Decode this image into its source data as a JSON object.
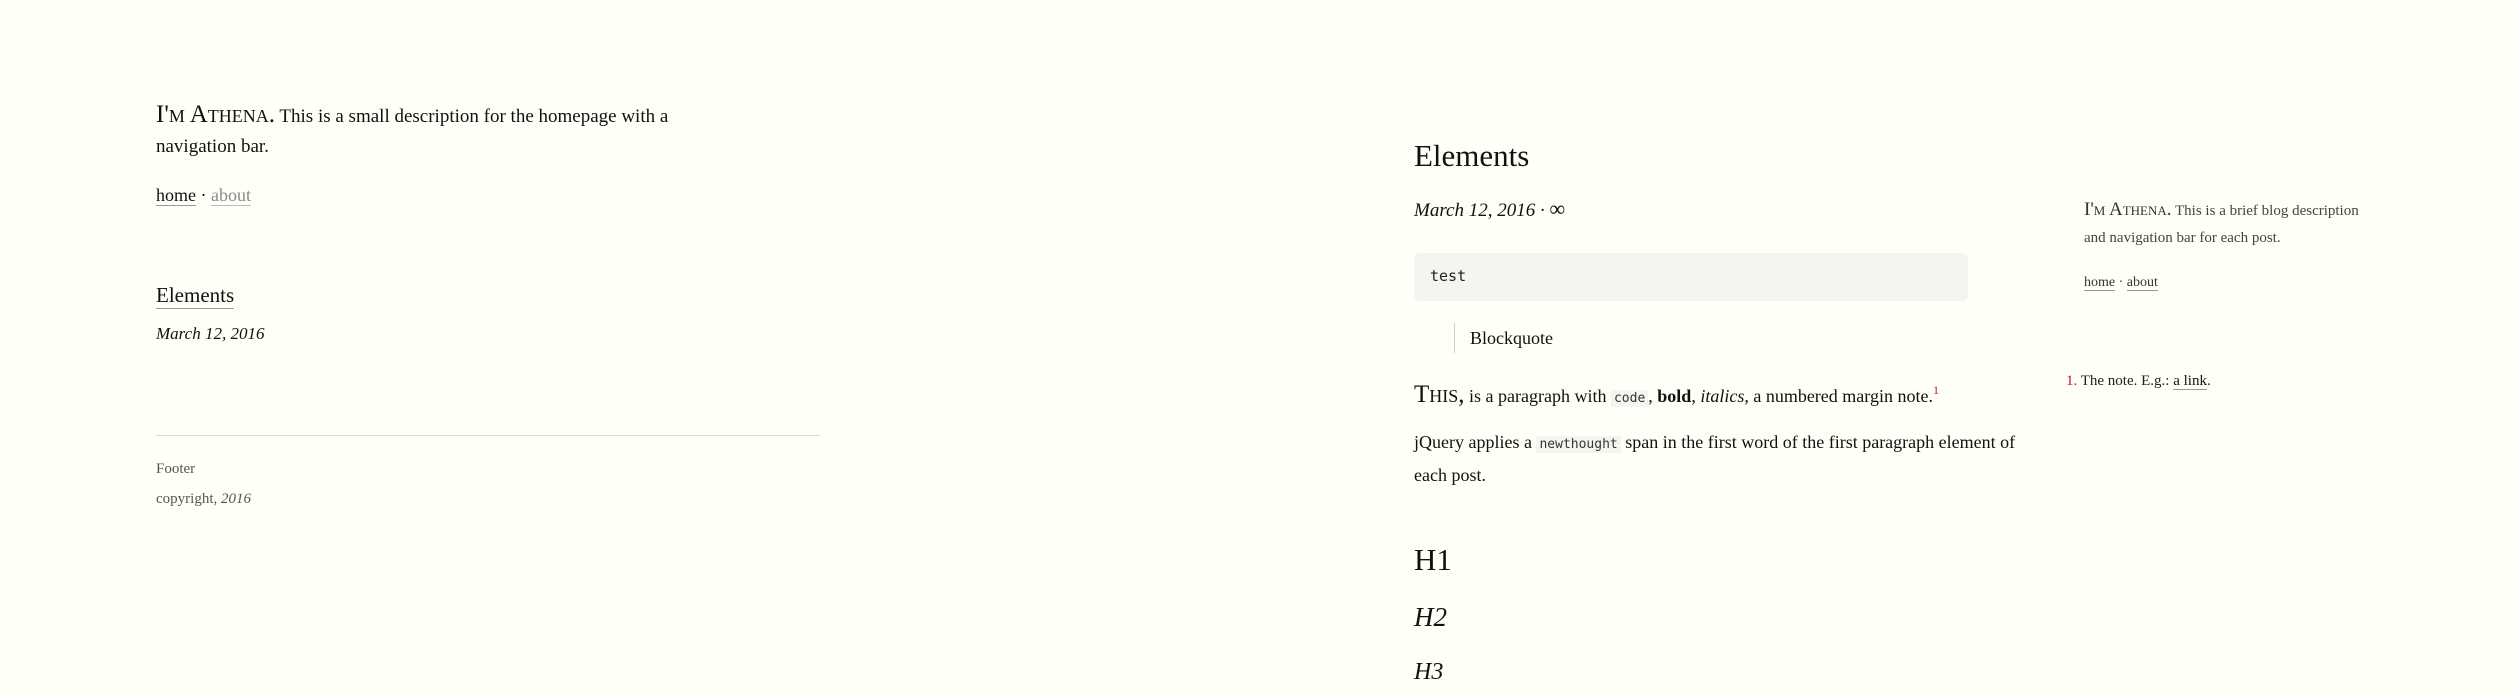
{
  "home": {
    "brand": "I'm Athena.",
    "description": "This is a small description for the homepage with a navigation bar.",
    "nav": {
      "home": "home",
      "separator": "·",
      "about": "about"
    },
    "posts": [
      {
        "title": "Elements",
        "date": "March 12, 2016"
      }
    ],
    "footer": {
      "label": "Footer",
      "copyright_prefix": "copyright, ",
      "year": "2016"
    }
  },
  "post": {
    "title": "Elements",
    "date": "March 12, 2016",
    "date_separator": "·",
    "permalink": "∞",
    "code_block": "test",
    "blockquote": "Blockquote",
    "paragraph1": {
      "newthought": "This,",
      "before_code": " is a paragraph with ",
      "code": "code",
      "comma1": ", ",
      "bold": "bold",
      "comma2": ", ",
      "italic": "italics",
      "after": ", a numbered margin note.",
      "ref": "1"
    },
    "paragraph2": {
      "before": "jQuery applies a ",
      "code": "newthought",
      "after": " span in the first word of the first paragraph element of each post."
    },
    "headings": {
      "h1": "H1",
      "h2": "H2",
      "h3": "H3"
    }
  },
  "sidebar": {
    "brand": "I'm Athena.",
    "description": "This is a brief blog description and navigation bar for each post.",
    "nav": {
      "home": "home",
      "separator": "·",
      "about": "about"
    },
    "note": {
      "number": "1.",
      "text": "The note. E.g.: ",
      "link": "a link",
      "end": "."
    }
  }
}
